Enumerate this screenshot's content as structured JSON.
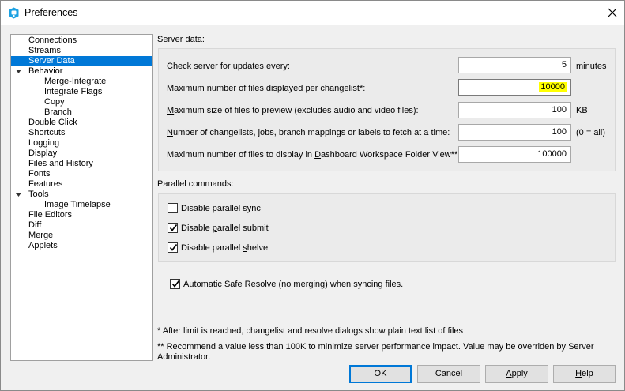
{
  "window": {
    "title": "Preferences"
  },
  "sidebar": {
    "items": [
      {
        "label": "Connections"
      },
      {
        "label": "Streams"
      },
      {
        "label": "Server Data"
      },
      {
        "label": "Behavior"
      },
      {
        "label": "Merge-Integrate"
      },
      {
        "label": "Integrate Flags"
      },
      {
        "label": "Copy"
      },
      {
        "label": "Branch"
      },
      {
        "label": "Double Click"
      },
      {
        "label": "Shortcuts"
      },
      {
        "label": "Logging"
      },
      {
        "label": "Display"
      },
      {
        "label": "Files and History"
      },
      {
        "label": "Fonts"
      },
      {
        "label": "Features"
      },
      {
        "label": "Tools"
      },
      {
        "label": "Image Timelapse"
      },
      {
        "label": "File Editors"
      },
      {
        "label": "Diff"
      },
      {
        "label": "Merge"
      },
      {
        "label": "Applets"
      }
    ]
  },
  "server_data": {
    "heading": "Server data:",
    "rows": [
      {
        "pre": "Check server for ",
        "ul": "u",
        "post": "pdates every:",
        "value": "5",
        "unit": "minutes"
      },
      {
        "pre": "Ma",
        "ul": "x",
        "post": "imum number of files displayed per changelist*:",
        "value": "10000",
        "unit": ""
      },
      {
        "pre": "",
        "ul": "M",
        "post": "aximum size of files to preview (excludes audio and video files):",
        "value": "100",
        "unit": "KB"
      },
      {
        "pre": "",
        "ul": "N",
        "post": "umber of changelists, jobs, branch mappings or labels to fetch at a time:",
        "value": "100",
        "unit": "(0 = all)"
      },
      {
        "pre": "Maximum number of files to display in ",
        "ul": "D",
        "post": "ashboard Workspace Folder View**:",
        "value": "100000",
        "unit": ""
      }
    ]
  },
  "parallel": {
    "heading": "Parallel commands:",
    "options": [
      {
        "pre": "",
        "ul": "D",
        "post": "isable parallel sync",
        "checked": false
      },
      {
        "pre": "Disable ",
        "ul": "p",
        "post": "arallel submit",
        "checked": true
      },
      {
        "pre": "Disable parallel ",
        "ul": "s",
        "post": "helve",
        "checked": true
      }
    ]
  },
  "safe_resolve": {
    "pre": "Automatic Safe ",
    "ul": "R",
    "post": "esolve (no merging) when syncing files.",
    "checked": true
  },
  "notes": {
    "note1": "* After limit is reached, changelist and resolve dialogs show plain text list of files",
    "note2_line1": "** Recommend a value less than 100K to minimize server performance impact. Value may be overriden by Server",
    "note2_line2": "Administrator."
  },
  "buttons": {
    "ok": "OK",
    "cancel": "Cancel",
    "apply": {
      "pre": "",
      "ul": "A",
      "post": "pply"
    },
    "help": {
      "pre": "",
      "ul": "H",
      "post": "elp"
    }
  },
  "colors": {
    "selection": "#0078d7",
    "highlight": "#ffff00",
    "app_icon": "#1ba1e2"
  }
}
